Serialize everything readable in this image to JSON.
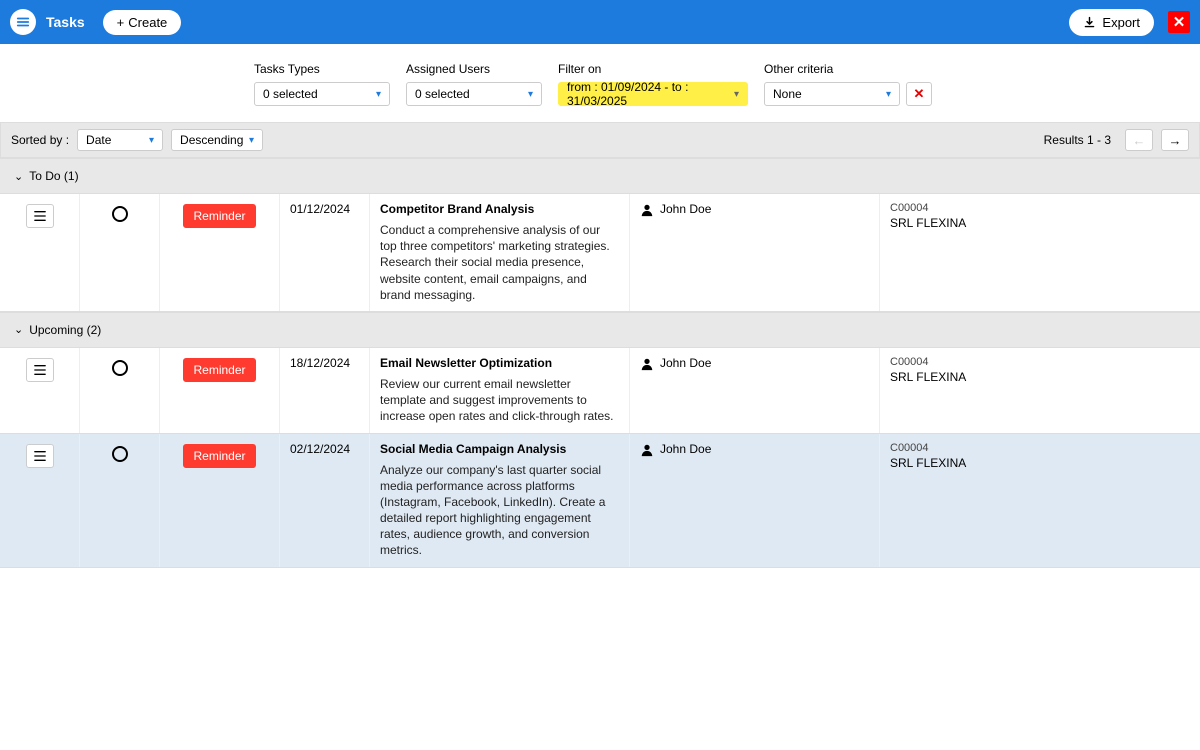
{
  "header": {
    "title": "Tasks",
    "create_label": "Create",
    "export_label": "Export"
  },
  "filters": {
    "types_label": "Tasks Types",
    "types_value": "0 selected",
    "users_label": "Assigned Users",
    "users_value": "0 selected",
    "filteron_label": "Filter on",
    "filteron_value": "from : 01/09/2024 - to : 31/03/2025",
    "criteria_label": "Other criteria",
    "criteria_value": "None"
  },
  "sort": {
    "label": "Sorted by :",
    "field": "Date",
    "direction": "Descending",
    "results": "Results 1 - 3"
  },
  "sections": {
    "todo_label": "To Do (1)",
    "upcoming_label": "Upcoming (2)"
  },
  "tasks": [
    {
      "tag": "Reminder",
      "date": "01/12/2024",
      "title": "Competitor Brand Analysis",
      "desc": "Conduct a comprehensive analysis of our top three competitors' marketing strategies. Research their social media presence, website content, email campaigns, and brand messaging.",
      "user": "John Doe",
      "company_code": "C00004",
      "company_name": "SRL FLEXINA"
    },
    {
      "tag": "Reminder",
      "date": "18/12/2024",
      "title": "Email Newsletter Optimization",
      "desc": "Review our current email newsletter template and suggest improvements to increase open rates and click-through rates.",
      "user": "John Doe",
      "company_code": "C00004",
      "company_name": "SRL FLEXINA"
    },
    {
      "tag": "Reminder",
      "date": "02/12/2024",
      "title": "Social Media Campaign Analysis",
      "desc": "Analyze our company's last quarter social media performance across platforms (Instagram, Facebook, LinkedIn). Create a detailed report highlighting engagement rates, audience growth, and conversion metrics.",
      "user": "John Doe",
      "company_code": "C00004",
      "company_name": "SRL FLEXINA"
    }
  ]
}
